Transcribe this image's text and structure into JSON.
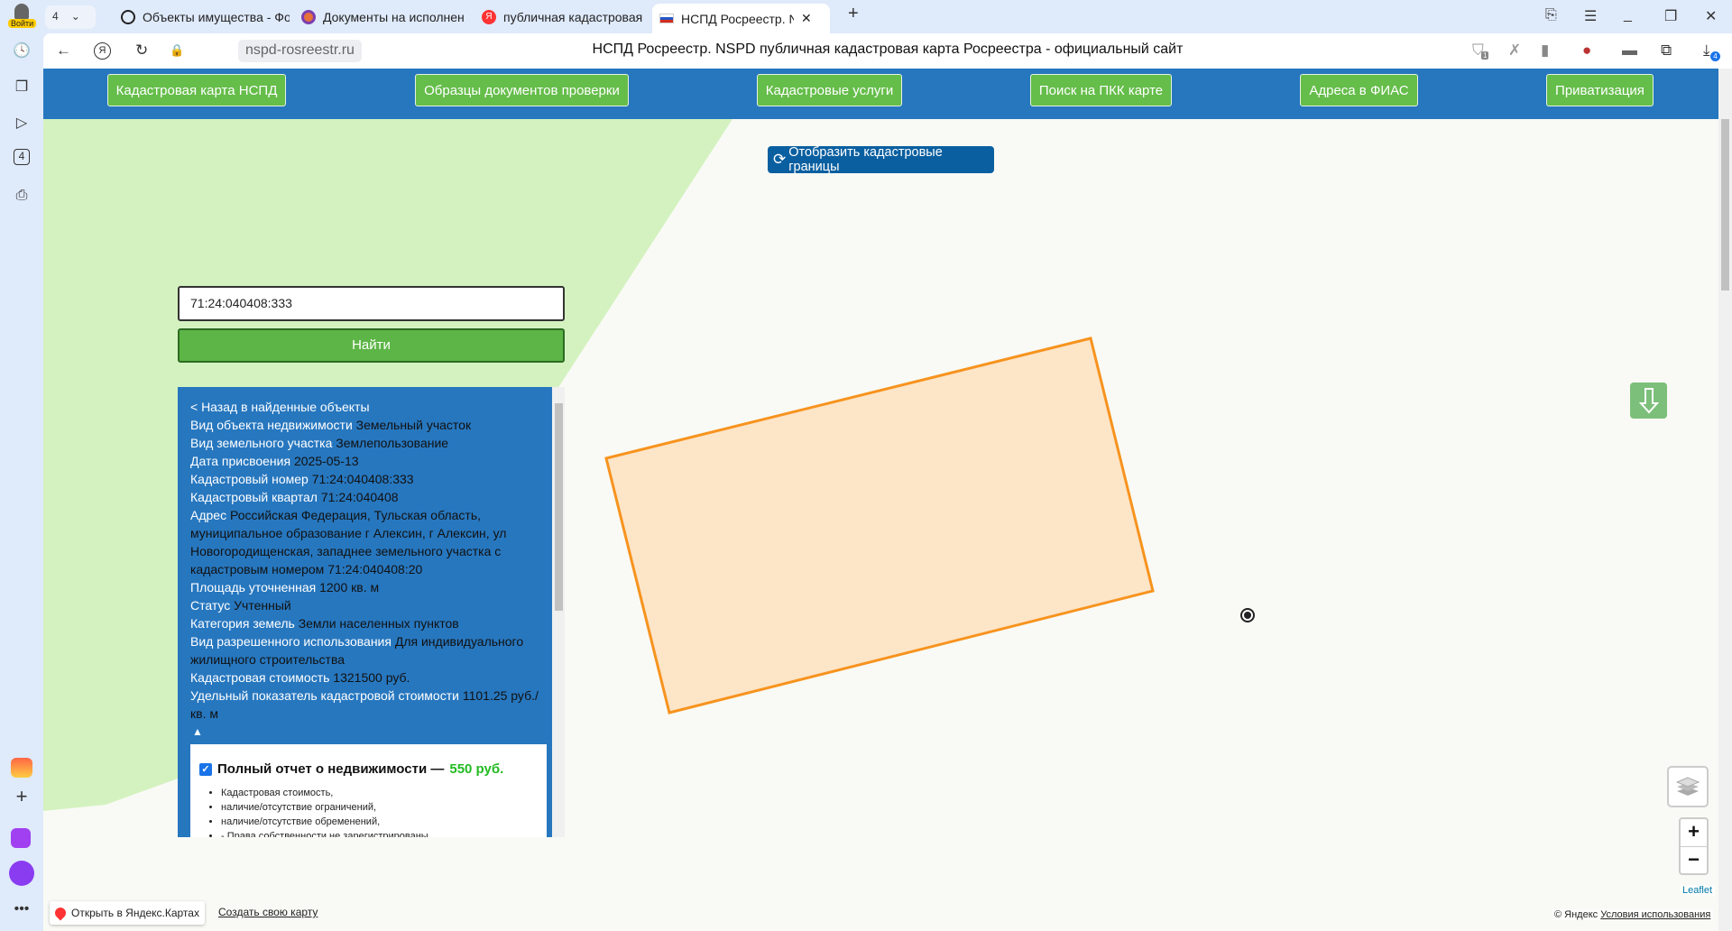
{
  "browser": {
    "login_label": "Войти",
    "tab_count": "4",
    "tabs": [
      {
        "title": "Объекты имущества - Фо",
        "active": false
      },
      {
        "title": "Документы на исполнен",
        "active": false
      },
      {
        "title": "публичная кадастровая",
        "active": false
      },
      {
        "title": "НСПД Росреестр. NSPD",
        "active": true
      }
    ],
    "url": "nspd-rosreestr.ru",
    "page_title": "НСПД Росреестр. NSPD публичная кадастровая карта Росреестра - официальный сайт",
    "shield_badge": "1",
    "downloads_badge": "4"
  },
  "nav": [
    "Кадастровая карта НСПД",
    "Образцы документов проверки",
    "Кадастровые услуги",
    "Поиск на ПКК карте",
    "Адреса в ФИАС",
    "Приватизация"
  ],
  "map": {
    "show_boundaries_label": "Отобразить кадастровые границы",
    "search_value": "71:24:040408:333",
    "find_label": "Найти",
    "leaflet": "Leaflet",
    "attribution": "© Яндекс",
    "terms": "Условия использования",
    "open_yandex": "Открыть в Яндекс.Картах",
    "create_map": "Создать свою карту",
    "zoom_in": "+",
    "zoom_out": "−"
  },
  "info": {
    "back": "< Назад в найденные объекты",
    "rows": [
      {
        "label": "Вид объекта недвижимости",
        "value": "Земельный участок"
      },
      {
        "label": "Вид земельного участка",
        "value": "Землепользование"
      },
      {
        "label": "Дата присвоения",
        "value": "2025-05-13"
      },
      {
        "label": "Кадастровый номер",
        "value": "71:24:040408:333"
      },
      {
        "label": "Кадастровый квартал",
        "value": "71:24:040408"
      },
      {
        "label": "Адрес",
        "value": "Российская Федерация, Тульская область, муниципальное образование г Алексин, г Алексин, ул Новогородищенская, западнее земельного участка с кадастровым номером 71:24:040408:20"
      },
      {
        "label": "Площадь уточненная",
        "value": "1200 кв. м"
      },
      {
        "label": "Статус",
        "value": "Учтенный"
      },
      {
        "label": "Категория земель",
        "value": "Земли населенных пунктов"
      },
      {
        "label": "Вид разрешенного использования",
        "value": "Для индивидуального жилищного строительства"
      },
      {
        "label": "Кадастровая стоимость",
        "value": "1321500 руб."
      },
      {
        "label": "Удельный показатель кадастровой стоимости",
        "value": "1101.25 руб./кв. м"
      }
    ],
    "collapse": "▲",
    "report": {
      "title": "Полный отчет о недвижимости —",
      "price": "550 руб.",
      "items": [
        "Кадастровая стоимость,",
        "наличие/отсутствие ограничений,",
        "наличие/отсутствие обременений,",
        "- Права собственности не зарегистрированы,"
      ]
    }
  }
}
